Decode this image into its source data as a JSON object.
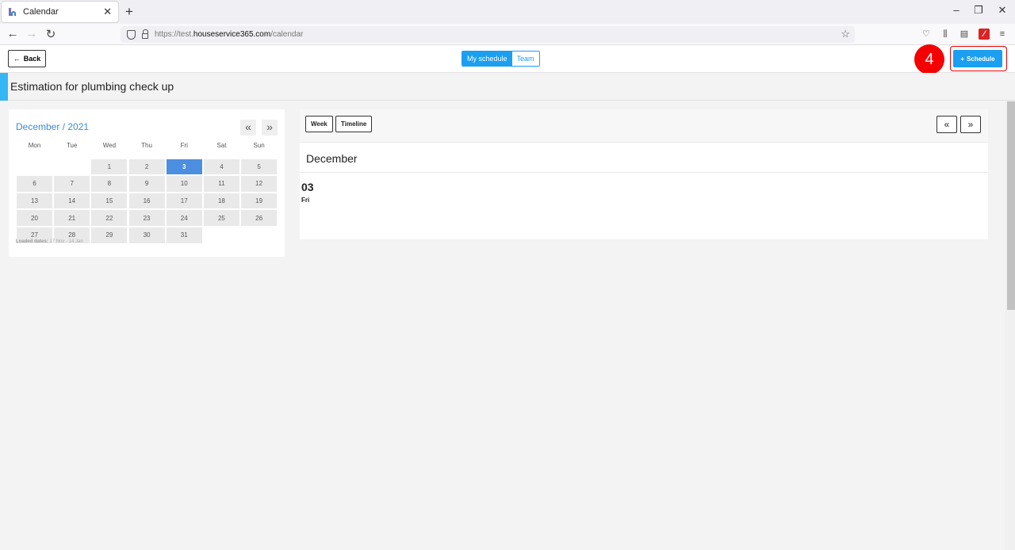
{
  "browser": {
    "tab_title": "Calendar",
    "new_tab": "+",
    "tab_close": "✕",
    "url_scheme": "https://test.",
    "url_host": "houseservice365.com",
    "url_path": "/calendar"
  },
  "header": {
    "back_label": "Back",
    "back_arrow": "←",
    "tabs": [
      {
        "label": "My schedule",
        "active": true
      },
      {
        "label": "Team",
        "active": false
      }
    ],
    "step_marker": "4",
    "schedule_label": "Schedule",
    "schedule_plus": "+"
  },
  "page": {
    "title": "Estimation for plumbing check up"
  },
  "mini_calendar": {
    "title": "December / 2021",
    "prev": "«",
    "next": "»",
    "weekdays": [
      "Mon",
      "Tue",
      "Wed",
      "Thu",
      "Fri",
      "Sat",
      "Sun"
    ],
    "leading_empty": 2,
    "days": [
      "1",
      "2",
      "3",
      "4",
      "5",
      "6",
      "7",
      "8",
      "9",
      "10",
      "11",
      "12",
      "13",
      "14",
      "15",
      "16",
      "17",
      "18",
      "19",
      "20",
      "21",
      "22",
      "23",
      "24",
      "25",
      "26",
      "27",
      "28",
      "29",
      "30",
      "31"
    ],
    "selected_day": "3",
    "loaded_label": "Loaded dates:",
    "loaded_range": "17 Nov - 14 Jan"
  },
  "main_calendar": {
    "view_week": "Week",
    "view_timeline": "Timeline",
    "prev": "«",
    "next": "»",
    "month": "December",
    "day_number": "03",
    "day_name": "Fri"
  },
  "colors": {
    "accent": "#1b9ff0",
    "marker": "#f50000",
    "today": "#4c8ee0"
  }
}
